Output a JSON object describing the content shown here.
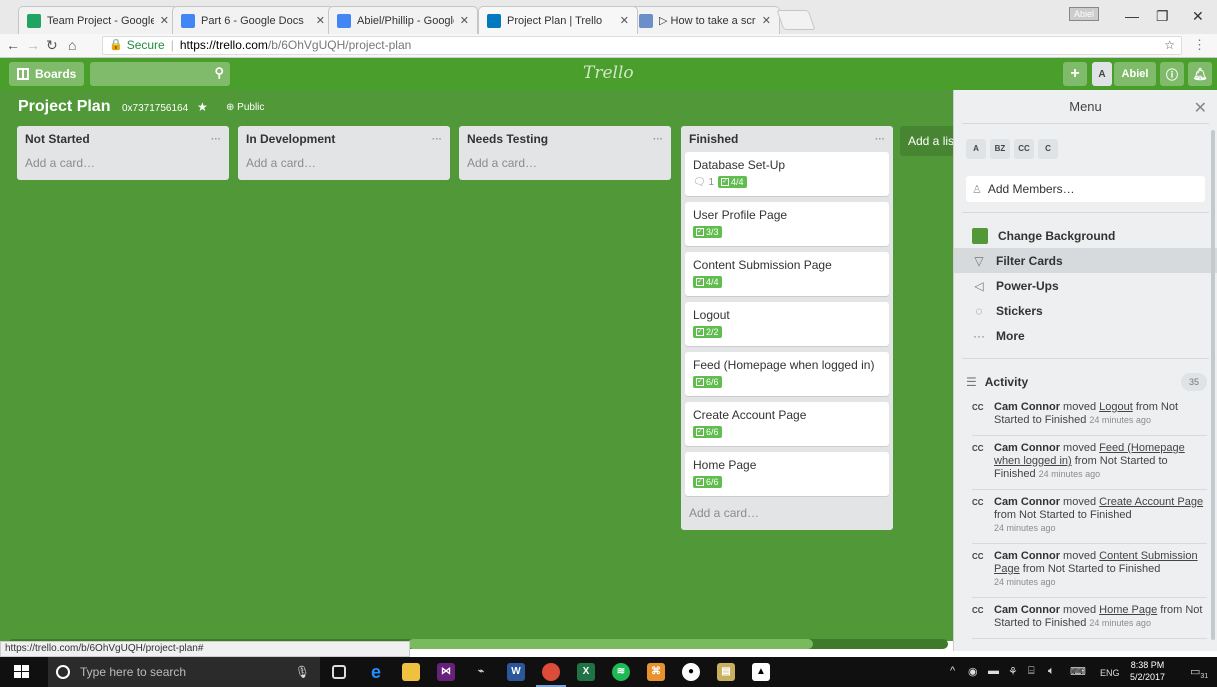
{
  "browser": {
    "tabs": [
      {
        "label": "Team Project - Google D",
        "color": "#1fa463"
      },
      {
        "label": "Part 6 - Google Docs",
        "color": "#4285f4"
      },
      {
        "label": "Abiel/Phillip - Google Do",
        "color": "#4285f4"
      },
      {
        "label": "Project Plan | Trello",
        "color": "#0079bf"
      },
      {
        "label": "▷ How to take a screens",
        "color": "#6a8fc9"
      }
    ],
    "profile_label": "Abiel",
    "secure_label": "Secure",
    "url_host": "https://trello.com",
    "url_path": "/b/6OhVgUQH/project-plan",
    "status_url": "https://trello.com/b/6OhVgUQH/project-plan#"
  },
  "trello_header": {
    "boards_label": "Boards",
    "logo": "Trello",
    "user_initial": "A",
    "user_name": "Abiel"
  },
  "board": {
    "title": "Project Plan",
    "id": "0x7371756164",
    "visibility": "Public",
    "add_list_label": "Add a list…",
    "add_card_label": "Add a card…",
    "background_color": "#519839",
    "lists": [
      {
        "name": "Not Started",
        "cards": []
      },
      {
        "name": "In Development",
        "cards": []
      },
      {
        "name": "Needs Testing",
        "cards": []
      },
      {
        "name": "Finished",
        "cards": [
          {
            "title": "Database Set-Up",
            "comments": "1",
            "checklist": "4/4"
          },
          {
            "title": "User Profile Page",
            "checklist": "3/3"
          },
          {
            "title": "Content Submission Page",
            "checklist": "4/4"
          },
          {
            "title": "Logout",
            "checklist": "2/2"
          },
          {
            "title": "Feed (Homepage when logged in)",
            "checklist": "6/6"
          },
          {
            "title": "Create Account Page",
            "checklist": "6/6"
          },
          {
            "title": "Home Page",
            "checklist": "6/6"
          }
        ]
      }
    ]
  },
  "menu": {
    "title": "Menu",
    "members": [
      "A",
      "BZ",
      "CC",
      "C"
    ],
    "add_members": "Add Members…",
    "items": [
      "Change Background",
      "Filter Cards",
      "Power-Ups",
      "Stickers",
      "More"
    ],
    "activity_label": "Activity",
    "activity_count": "35",
    "activity": [
      {
        "initials": "CC",
        "user": "Cam Connor",
        "pre": " moved ",
        "card": "Logout",
        "post": " from Not Started to Finished",
        "time": "24 minutes ago"
      },
      {
        "initials": "CC",
        "user": "Cam Connor",
        "pre": " moved ",
        "card": "Feed (Homepage when logged in)",
        "post": " from Not Started to Finished",
        "time": "24 minutes ago"
      },
      {
        "initials": "CC",
        "user": "Cam Connor",
        "pre": " moved ",
        "card": "Create Account Page",
        "post": " from Not Started to Finished",
        "time": "24 minutes ago"
      },
      {
        "initials": "CC",
        "user": "Cam Connor",
        "pre": " moved ",
        "card": "Content Submission Page",
        "post": " from Not Started to Finished",
        "time": "24 minutes ago"
      },
      {
        "initials": "CC",
        "user": "Cam Connor",
        "pre": " moved ",
        "card": "Home Page",
        "post": " from Not Started to Finished",
        "time": "24 minutes ago"
      }
    ]
  },
  "taskbar": {
    "search_placeholder": "Type here to search",
    "lang": "ENG",
    "time": "8:38 PM",
    "date": "5/2/2017",
    "notifications": "31"
  }
}
